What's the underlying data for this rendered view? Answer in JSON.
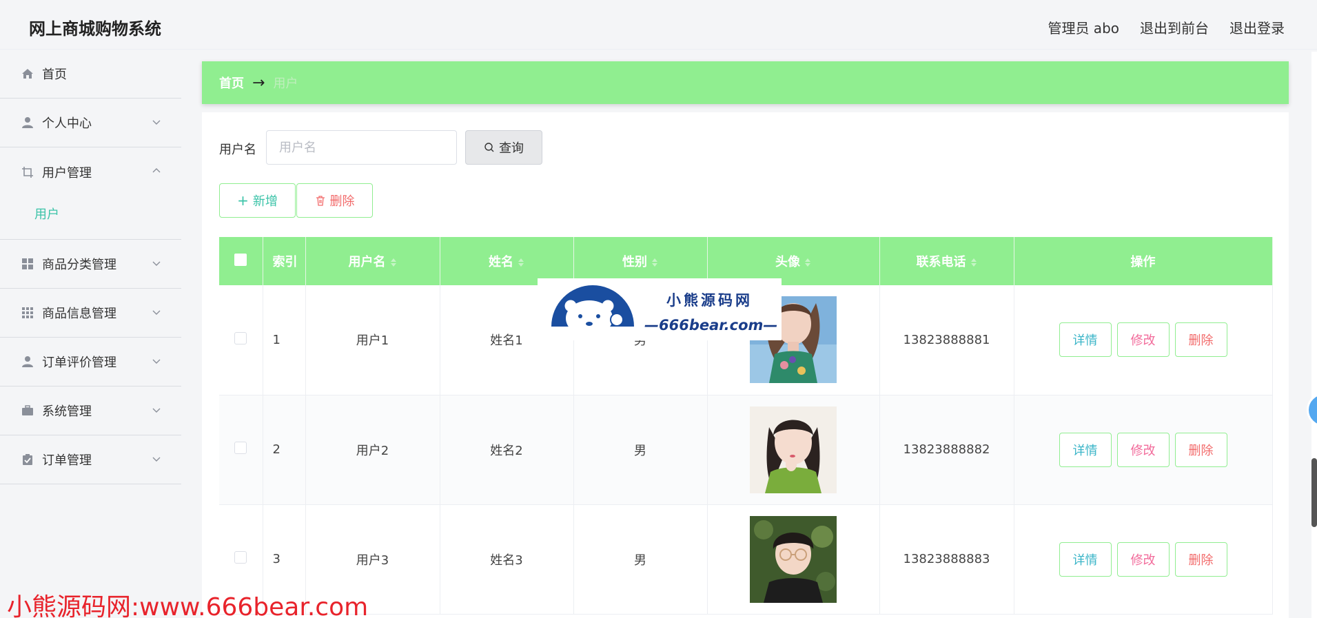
{
  "app": {
    "title": "网上商城购物系统"
  },
  "topnav": {
    "admin": "管理员 abo",
    "to_front": "退出到前台",
    "logout": "退出登录"
  },
  "sidebar": {
    "home": "首页",
    "personal": "个人中心",
    "user_mgmt": "用户管理",
    "user_sub": "用户",
    "category_mgmt": "商品分类管理",
    "goods_mgmt": "商品信息管理",
    "review_mgmt": "订单评价管理",
    "system_mgmt": "系统管理",
    "order_mgmt": "订单管理"
  },
  "breadcrumb": {
    "home": "首页",
    "current": "用户"
  },
  "search": {
    "label": "用户名",
    "placeholder": "用户名",
    "value": "",
    "button": "查询"
  },
  "actions": {
    "add": "新增",
    "delete": "删除"
  },
  "table": {
    "headers": {
      "index": "索引",
      "username": "用户名",
      "name": "姓名",
      "gender": "性别",
      "avatar": "头像",
      "phone": "联系电话",
      "ops": "操作"
    },
    "rows": [
      {
        "index": "1",
        "username": "用户1",
        "name": "姓名1",
        "gender": "男",
        "phone": "13823888881",
        "detail": "详情",
        "edit": "修改",
        "del": "删除"
      },
      {
        "index": "2",
        "username": "用户2",
        "name": "姓名2",
        "gender": "男",
        "phone": "13823888882",
        "detail": "详情",
        "edit": "修改",
        "del": "删除"
      },
      {
        "index": "3",
        "username": "用户3",
        "name": "姓名3",
        "gender": "男",
        "phone": "13823888883",
        "detail": "详情",
        "edit": "修改",
        "del": "删除"
      }
    ]
  },
  "watermark": {
    "title": "小熊源码网",
    "url": "—666bear.com—",
    "bottom": "小熊源码网:www.666bear.com"
  },
  "colors": {
    "accent": "#90ee90",
    "teal": "#3bc3a8",
    "danger": "#f26a6a",
    "pink": "#f26a9a"
  }
}
